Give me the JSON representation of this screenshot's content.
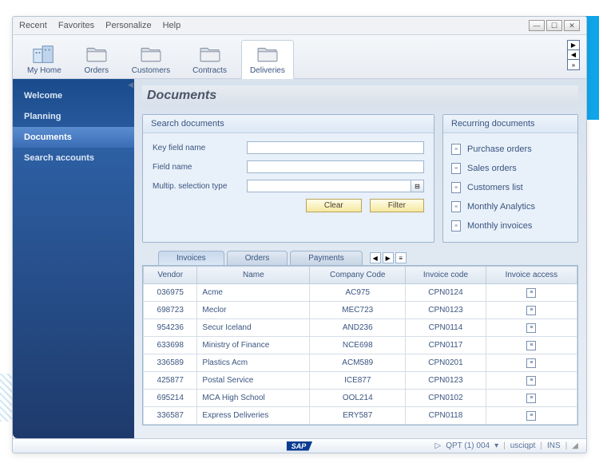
{
  "menubar": [
    "Recent",
    "Favorites",
    "Personalize",
    "Help"
  ],
  "toolbar": [
    {
      "label": "My Home",
      "icon": "building"
    },
    {
      "label": "Orders",
      "icon": "folder"
    },
    {
      "label": "Customers",
      "icon": "folder"
    },
    {
      "label": "Contracts",
      "icon": "folder"
    },
    {
      "label": "Deliveries",
      "icon": "folder",
      "active": true
    }
  ],
  "sidebar": {
    "items": [
      "Welcome",
      "Planning",
      "Documents",
      "Search accounts"
    ],
    "active": 2
  },
  "page_title": "Documents",
  "search": {
    "title": "Search documents",
    "fields": [
      {
        "label": "Key field name",
        "value": ""
      },
      {
        "label": "Field name",
        "value": ""
      },
      {
        "label": "Multip. selection type",
        "value": "",
        "hasIcon": true
      }
    ],
    "buttons": {
      "clear": "Clear",
      "filter": "Filter"
    }
  },
  "recurring": {
    "title": "Recurring documents",
    "items": [
      "Purchase orders",
      "Sales orders",
      "Customers list",
      "Monthly Analytics",
      "Monthly invoices"
    ]
  },
  "tabs": {
    "items": [
      "Invoices",
      "Orders",
      "Payments"
    ],
    "active": 0
  },
  "table": {
    "headers": [
      "Vendor",
      "Name",
      "Company Code",
      "Invoice code",
      "Invoice access"
    ],
    "rows": [
      [
        "036975",
        "Acme",
        "AC975",
        "CPN0124"
      ],
      [
        "698723",
        "Meclor",
        "MEC723",
        "CPN0123"
      ],
      [
        "954236",
        "Secur Iceland",
        "AND236",
        "CPN0114"
      ],
      [
        "633698",
        "Ministry of Finance",
        "NCE698",
        "CPN0117"
      ],
      [
        "336589",
        "Plastics Acm",
        "ACM589",
        "CPN0201"
      ],
      [
        "425877",
        "Postal Service",
        "ICE877",
        "CPN0123"
      ],
      [
        "695214",
        "MCA High School",
        "OOL214",
        "CPN0102"
      ],
      [
        "336587",
        "Express Deliveries",
        "ERY587",
        "CPN0118"
      ]
    ]
  },
  "status": {
    "sap": "SAP",
    "system": "QPT (1) 004",
    "user": "usciqpt",
    "mode": "INS"
  }
}
